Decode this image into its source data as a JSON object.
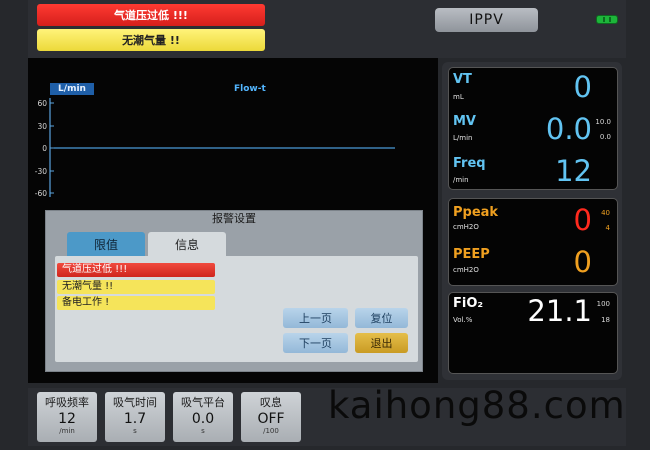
{
  "header": {
    "alarm_high": "气道压过低 !!!",
    "alarm_medium": "无潮气量 !!",
    "mode": "IPPV"
  },
  "waveform": {
    "unit": "L/min",
    "title": "Flow-t",
    "ticks": [
      "60",
      "30",
      "0",
      "-30",
      "-60"
    ]
  },
  "alarm_panel": {
    "title": "报警设置",
    "tabs": [
      "限值",
      "信息"
    ],
    "messages": [
      "气道压过低 !!!",
      "无潮气量 !!",
      "备电工作 !"
    ],
    "buttons": {
      "prev": "上一页",
      "reset": "复位",
      "next": "下一页",
      "exit": "退出"
    }
  },
  "monitor": {
    "vt": {
      "name": "VT",
      "unit": "mL",
      "value": "0"
    },
    "mv": {
      "name": "MV",
      "unit": "L/min",
      "value": "0.0",
      "limit_high": "10.0",
      "limit_low": "0.0"
    },
    "freq": {
      "name": "Freq",
      "unit": "/min",
      "value": "12"
    },
    "ppeak": {
      "name": "Ppeak",
      "unit": "cmH2O",
      "value": "0",
      "limit_high": "40",
      "limit_low": "4"
    },
    "peep": {
      "name": "PEEP",
      "unit": "cmH2O",
      "value": "0"
    },
    "fio2": {
      "name": "FiO₂",
      "unit": "Vol.%",
      "value": "21.1",
      "limit_high": "100",
      "limit_low": "18"
    }
  },
  "settings": [
    {
      "label": "呼吸频率",
      "value": "12",
      "unit": "/min"
    },
    {
      "label": "吸气时间",
      "value": "1.7",
      "unit": "s"
    },
    {
      "label": "吸气平台",
      "value": "0.0",
      "unit": "s"
    },
    {
      "label": "叹息",
      "value": "OFF",
      "unit": "/100"
    }
  ],
  "watermark": "kaihong88.com",
  "colors": {
    "alarm_red": "#e0261f",
    "alarm_yellow": "#f5e45a",
    "param_blue": "#62c4f2",
    "param_orange": "#f0a020",
    "battery_green": "#1db53a"
  }
}
